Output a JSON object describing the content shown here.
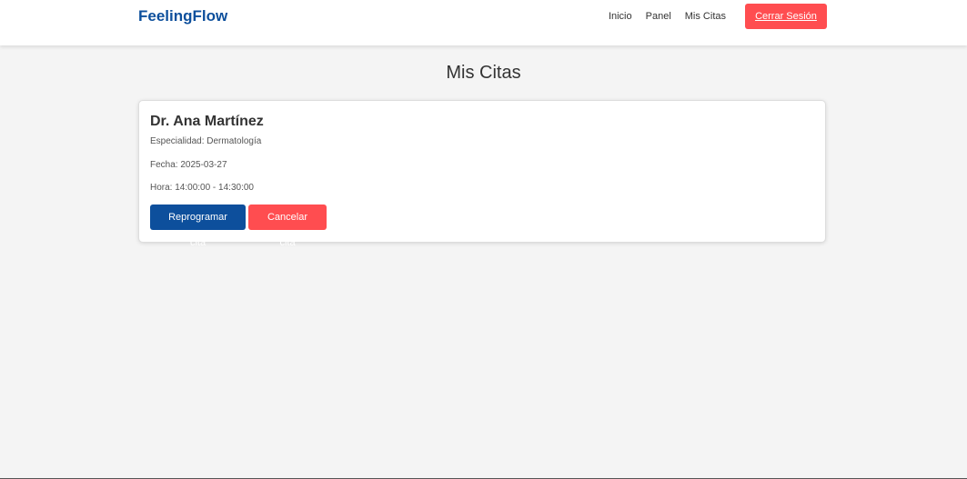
{
  "navbar": {
    "brand": "FeelingFlow",
    "links": [
      "Inicio",
      "Panel",
      "Mis Citas"
    ],
    "logout_label": "Cerrar Sesión"
  },
  "main": {
    "title": "Mis Citas",
    "appointments": [
      {
        "doctor": "Dr. Ana Martínez",
        "specialty": "Especialidad: Dermatología",
        "date": "Fecha: 2025-03-27",
        "time": "Hora: 14:00:00 - 14:30:00",
        "reschedule_label": "Reprogramar cita",
        "cancel_label": "Cancelar cita"
      }
    ]
  },
  "colors": {
    "brand": "#0d4f9c",
    "primary_button": "#0d4f9c",
    "danger_button": "#ff4d50",
    "background": "#f4f4f4"
  }
}
